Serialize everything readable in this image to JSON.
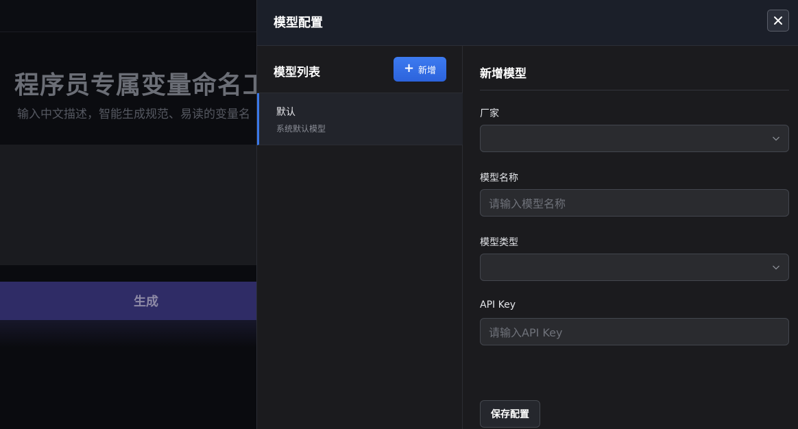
{
  "background": {
    "title": "程序员专属变量命名工具",
    "subtitle": "输入中文描述，智能生成规范、易读的变量名",
    "generate_label": "生成"
  },
  "drawer": {
    "title": "模型配置",
    "close_icon": "close-icon"
  },
  "model_list": {
    "title": "模型列表",
    "add_label": "新增",
    "add_icon": "plus-icon",
    "items": [
      {
        "name": "默认",
        "desc": "系统默认模型"
      }
    ]
  },
  "form": {
    "title": "新增模型",
    "vendor": {
      "label": "厂家",
      "value": ""
    },
    "model_name": {
      "label": "模型名称",
      "placeholder": "请输入模型名称"
    },
    "model_type": {
      "label": "模型类型",
      "value": ""
    },
    "api_key": {
      "label": "API Key",
      "placeholder": "请输入API Key"
    },
    "save_label": "保存配置"
  },
  "colors": {
    "accent": "#3a78e8",
    "generate_button": "#2f2c66",
    "drawer_bg": "#1b1b1e",
    "header_bg": "#1b1f29"
  }
}
